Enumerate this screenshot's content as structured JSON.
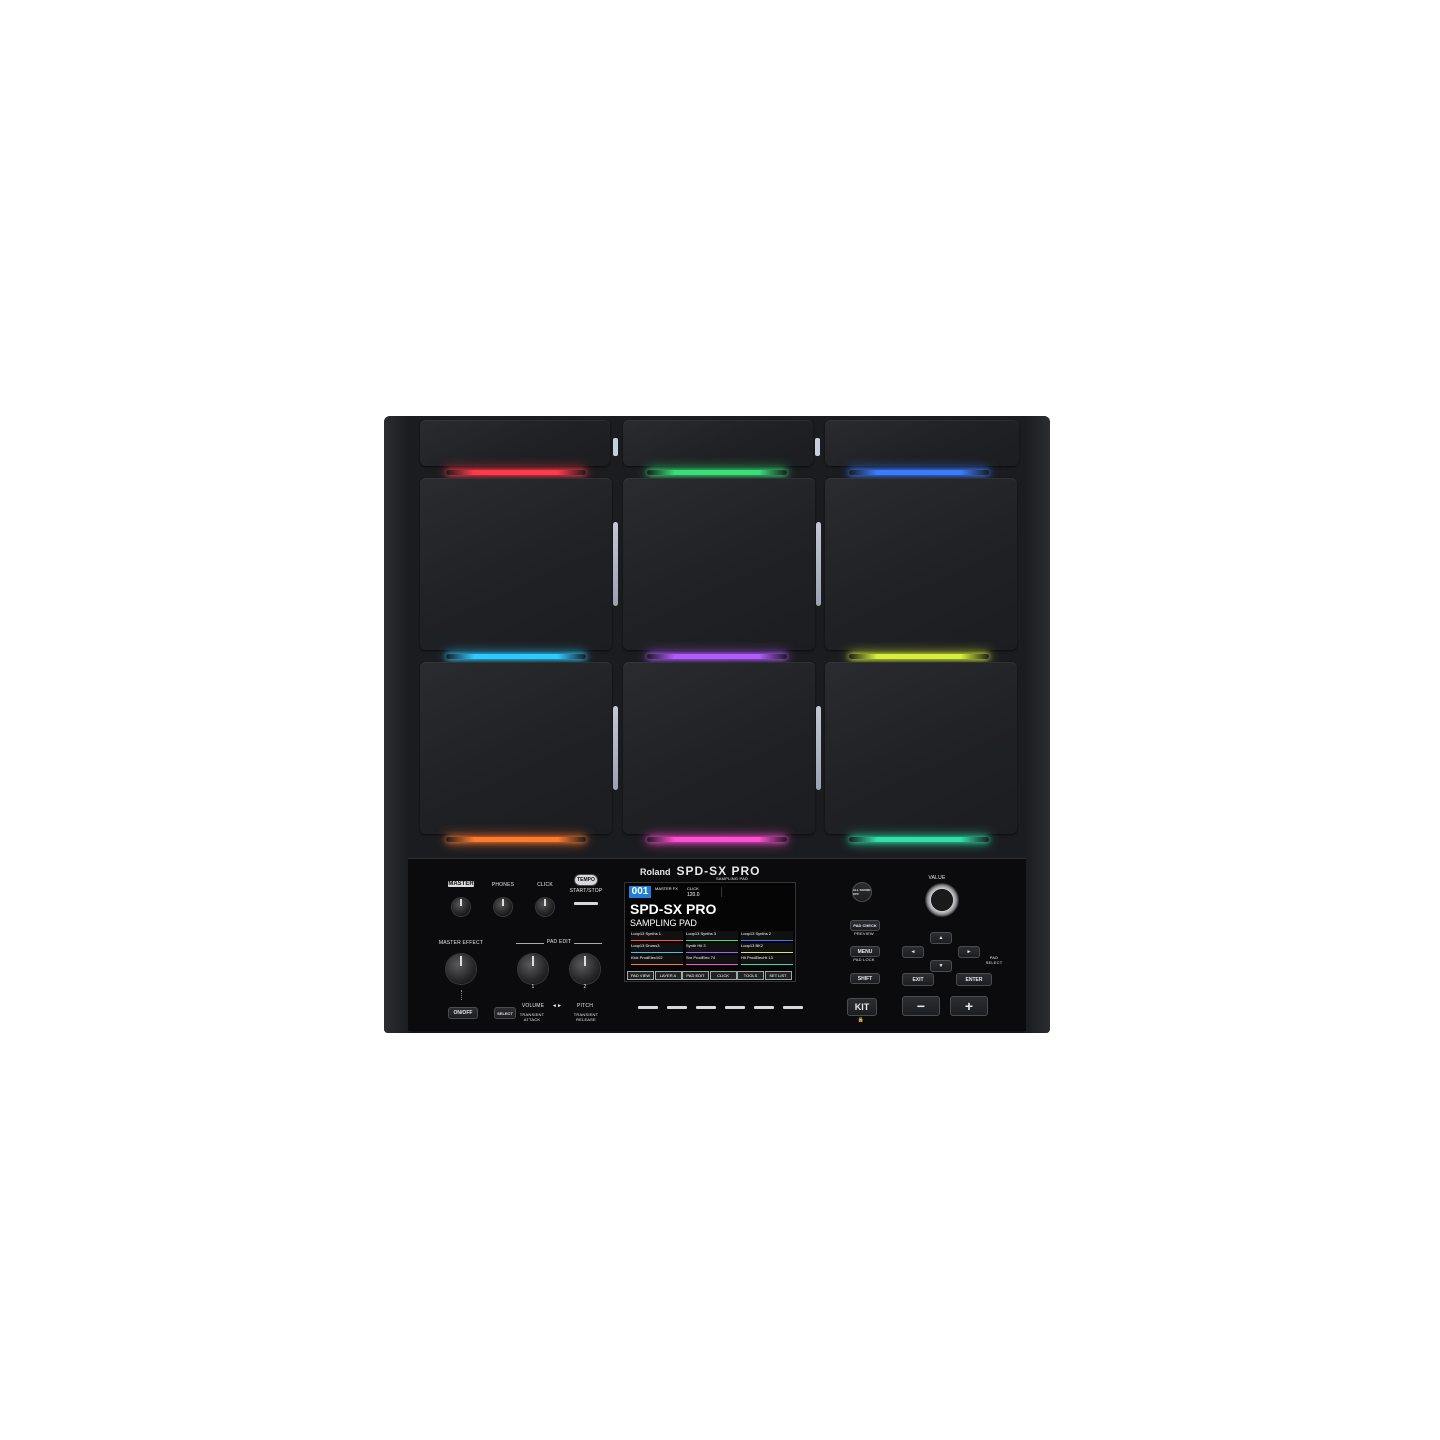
{
  "brand": "Roland",
  "model": "SPD-SX PRO",
  "model_sub": "SAMPLING PAD",
  "colors": {
    "led_top": [
      "#ff3a4a",
      "#39e07a",
      "#3a7bff"
    ],
    "led_mid": [
      "#2ec9ff",
      "#b25bff",
      "#d8f03a"
    ],
    "led_bottom": [
      "#ff7a2e",
      "#ff4fd2",
      "#2fe0a8"
    ],
    "screen_accent": "#1e7fd6"
  },
  "controls": {
    "master": "MASTER",
    "phones": "PHONES",
    "click": "CLICK",
    "tempo": "TEMPO",
    "start_stop": "START/STOP",
    "master_effect": "MASTER EFFECT",
    "pad_edit": "PAD EDIT",
    "on_off": "ON/OFF",
    "select": "SELECT",
    "volume": "VOLUME",
    "pitch": "PITCH",
    "transient_attack": "TRANSIENT ATTACK",
    "transient_release": "TRANSIENT RELEASE",
    "knob1": "1",
    "knob2": "2"
  },
  "screen": {
    "kit_number": "001",
    "master_fx": "MASTER FX",
    "click": "CLICK",
    "tempo": "120.0",
    "title": "SPD-SX PRO",
    "subtitle": "SAMPLING PAD",
    "pads": [
      "Loop13 Synths 1",
      "Loop13 Synths 3",
      "Loop13 Synths 2",
      "Loop13 Drums3",
      "Synth Hit 3",
      "Loop13 BK2",
      "Kick ProdElec102",
      "Snr ProdElec 74",
      "Hit ProdElecHt 13"
    ],
    "fkeys": [
      "PAD VIEW",
      "LAYER A",
      "PAD EDIT",
      "CLICK",
      "TOOLS",
      "SET LIST"
    ]
  },
  "right": {
    "value": "VALUE",
    "all_sound_off": "ALL SOUND OFF",
    "pad_check": "PAD CHECK",
    "preview": "PREVIEW",
    "menu": "MENU",
    "pad_lock": "PAD LOCK",
    "shift": "SHIFT",
    "exit": "EXIT",
    "enter": "ENTER",
    "pad_select": "PAD SELECT",
    "kit": "KIT",
    "minus": "−",
    "plus": "+"
  },
  "icons": {
    "up": "▲",
    "down": "▼",
    "left": "◄",
    "right": "►",
    "lock": "🔒"
  }
}
